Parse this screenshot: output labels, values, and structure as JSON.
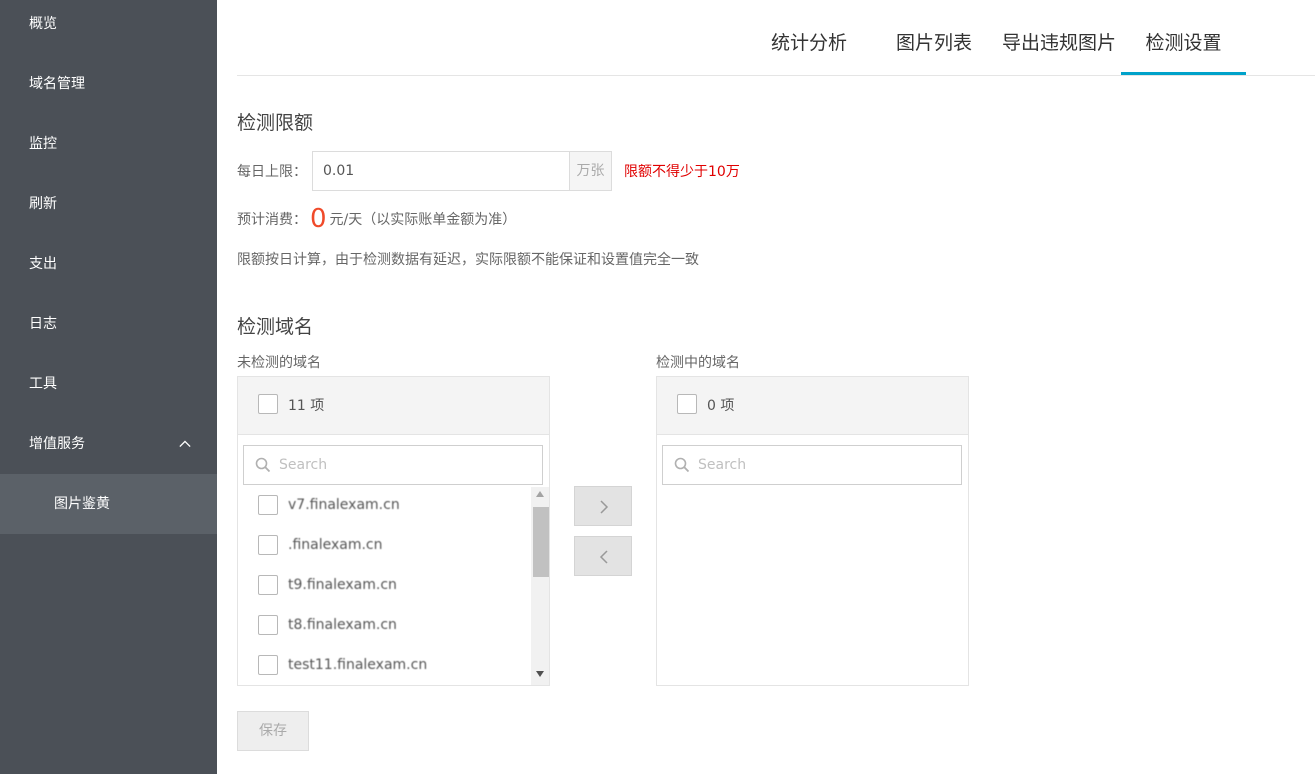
{
  "sidebar": {
    "items": [
      {
        "label": "概览"
      },
      {
        "label": "域名管理"
      },
      {
        "label": "监控"
      },
      {
        "label": "刷新"
      },
      {
        "label": "支出"
      },
      {
        "label": "日志"
      },
      {
        "label": "工具"
      },
      {
        "label": "增值服务",
        "expanded": true
      },
      {
        "label": "图片鉴黄",
        "selected": true
      }
    ]
  },
  "tabs": [
    {
      "label": "统计分析"
    },
    {
      "label": "图片列表"
    },
    {
      "label": "导出违规图片"
    },
    {
      "label": "检测设置",
      "active": true
    }
  ],
  "quota": {
    "title": "检测限额",
    "daily_label": "每日上限：",
    "daily_value": "0.01",
    "unit": "万张",
    "warning": "限额不得少于10万",
    "cost_label": "预计消费：",
    "cost_value": "0",
    "cost_suffix": "元/天（以实际账单金额为准）",
    "note": "限额按日计算，由于检测数据有延迟，实际限额不能保证和设置值完全一致"
  },
  "domains": {
    "title": "检测域名",
    "left": {
      "label": "未检测的域名",
      "count": "11 项",
      "search_placeholder": "Search",
      "items": [
        "v7.finalexam.cn",
        ".finalexam.cn",
        "t9.finalexam.cn",
        "t8.finalexam.cn",
        "test11.finalexam.cn"
      ]
    },
    "right": {
      "label": "检测中的域名",
      "count": "0 项",
      "search_placeholder": "Search",
      "items": []
    }
  },
  "save_label": "保存",
  "colors": {
    "sidebar_bg": "#4b5057",
    "accent": "#00a2ca",
    "warning": "#e00000",
    "cost": "#f04a2a"
  }
}
